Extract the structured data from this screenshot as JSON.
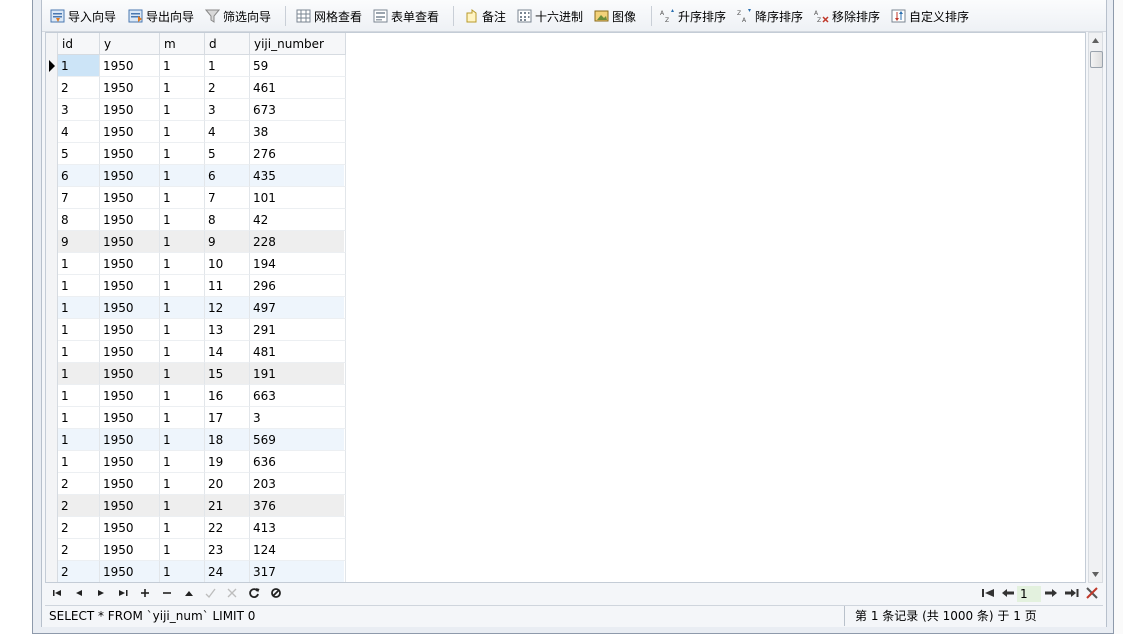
{
  "toolbar": {
    "import_wizard": "导入向导",
    "export_wizard": "导出向导",
    "filter_wizard": "筛选向导",
    "grid_view": "网格查看",
    "form_view": "表单查看",
    "memo": "备注",
    "hex": "十六进制",
    "image": "图像",
    "sort_asc": "升序排序",
    "sort_desc": "降序排序",
    "remove_sort": "移除排序",
    "custom_sort": "自定义排序"
  },
  "columns": [
    "id",
    "y",
    "m",
    "d",
    "yiji_number"
  ],
  "rows": [
    [
      "1",
      "1950",
      "1",
      "1",
      "59"
    ],
    [
      "2",
      "1950",
      "1",
      "2",
      "461"
    ],
    [
      "3",
      "1950",
      "1",
      "3",
      "673"
    ],
    [
      "4",
      "1950",
      "1",
      "4",
      "38"
    ],
    [
      "5",
      "1950",
      "1",
      "5",
      "276"
    ],
    [
      "6",
      "1950",
      "1",
      "6",
      "435"
    ],
    [
      "7",
      "1950",
      "1",
      "7",
      "101"
    ],
    [
      "8",
      "1950",
      "1",
      "8",
      "42"
    ],
    [
      "9",
      "1950",
      "1",
      "9",
      "228"
    ],
    [
      "1",
      "1950",
      "1",
      "10",
      "194"
    ],
    [
      "1",
      "1950",
      "1",
      "11",
      "296"
    ],
    [
      "1",
      "1950",
      "1",
      "12",
      "497"
    ],
    [
      "1",
      "1950",
      "1",
      "13",
      "291"
    ],
    [
      "1",
      "1950",
      "1",
      "14",
      "481"
    ],
    [
      "1",
      "1950",
      "1",
      "15",
      "191"
    ],
    [
      "1",
      "1950",
      "1",
      "16",
      "663"
    ],
    [
      "1",
      "1950",
      "1",
      "17",
      "3"
    ],
    [
      "1",
      "1950",
      "1",
      "18",
      "569"
    ],
    [
      "1",
      "1950",
      "1",
      "19",
      "636"
    ],
    [
      "2",
      "1950",
      "1",
      "20",
      "203"
    ],
    [
      "2",
      "1950",
      "1",
      "21",
      "376"
    ],
    [
      "2",
      "1950",
      "1",
      "22",
      "413"
    ],
    [
      "2",
      "1950",
      "1",
      "23",
      "124"
    ],
    [
      "2",
      "1950",
      "1",
      "24",
      "317"
    ]
  ],
  "row_shades": [
    "#ffffff",
    "#ffffff",
    "#ffffff",
    "#ffffff",
    "#ffffff",
    "#eef5fc",
    "#ffffff",
    "#ffffff",
    "#eeeeee",
    "#ffffff",
    "#ffffff",
    "#eef5fc",
    "#ffffff",
    "#ffffff",
    "#eeeeee",
    "#ffffff",
    "#ffffff",
    "#eef5fc",
    "#ffffff",
    "#ffffff",
    "#eeeeee",
    "#ffffff",
    "#ffffff",
    "#eef5fc"
  ],
  "selected_color": "#cce4f7",
  "nav": {
    "page_number": "1"
  },
  "status": {
    "sql": "SELECT * FROM `yiji_num` LIMIT 0",
    "record_info": "第 1 条记录 (共 1000 条) 于 1 页"
  },
  "icons": [
    "import-wizard-icon",
    "export-wizard-icon",
    "filter-icon",
    "grid-view-icon",
    "form-view-icon",
    "memo-icon",
    "hex-icon",
    "image-icon",
    "sort-asc-icon",
    "sort-desc-icon",
    "remove-sort-icon",
    "custom-sort-icon"
  ]
}
